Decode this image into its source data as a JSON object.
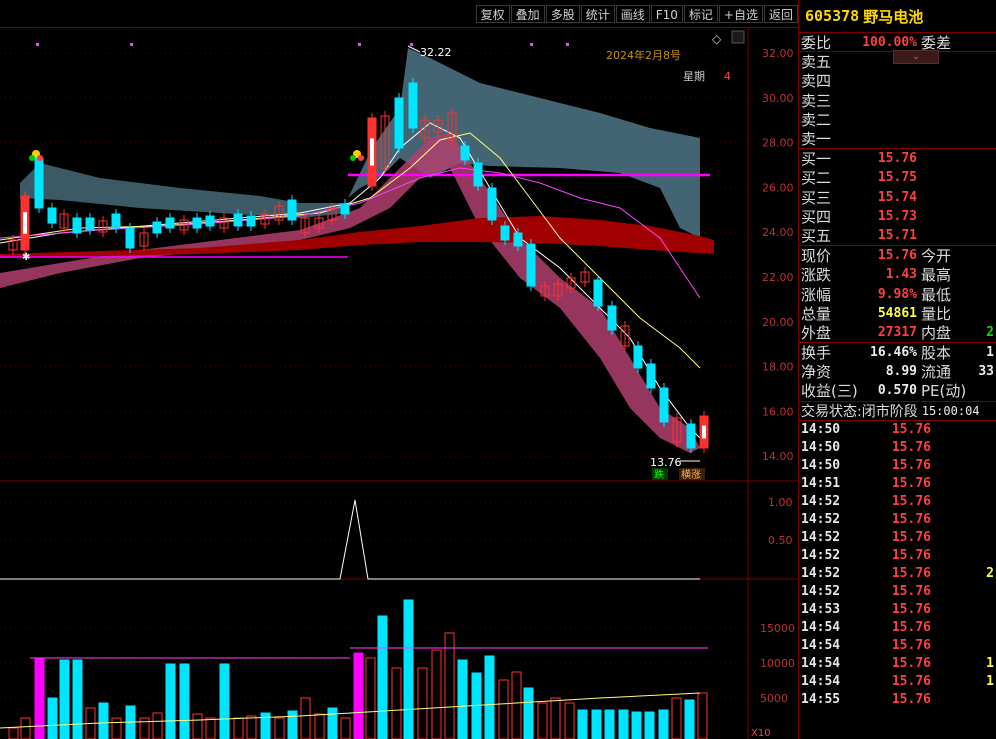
{
  "toolbar": {
    "buttons": [
      "复权",
      "叠加",
      "多股",
      "统计",
      "画线",
      "F10",
      "标记",
      "+自选",
      "返回"
    ]
  },
  "chart": {
    "date_label": "2024年2月8号",
    "weekday_label": "星期",
    "weekday_value": "4",
    "high_label": "32.22",
    "low_label": "13.76",
    "badge_left": "跌",
    "badge_right": "横涨",
    "price_ticks": [
      "32.00",
      "30.00",
      "28.00",
      "26.00",
      "24.00",
      "22.00",
      "20.00",
      "18.00",
      "16.00",
      "14.00"
    ],
    "ind_ticks": [
      "1.00",
      "0.50"
    ],
    "vol_ticks": [
      "15000",
      "10000",
      "5000"
    ],
    "vol_unit": "X10",
    "colors": {
      "up": "#ff3030",
      "down": "#00e5ff",
      "magenta": "#ff00ff",
      "cloud": "#4a7080",
      "band": "#b0003a"
    }
  },
  "stock": {
    "code": "605378",
    "name": "野马电池"
  },
  "weibi": {
    "label": "委比",
    "value": "100.00%",
    "label2": "委差"
  },
  "sells": [
    "卖五",
    "卖四",
    "卖三",
    "卖二",
    "卖一"
  ],
  "buys": [
    {
      "label": "买一",
      "price": "15.76"
    },
    {
      "label": "买二",
      "price": "15.75"
    },
    {
      "label": "买三",
      "price": "15.74"
    },
    {
      "label": "买四",
      "price": "15.73"
    },
    {
      "label": "买五",
      "price": "15.71"
    }
  ],
  "stats": [
    {
      "l1": "现价",
      "v1": "15.76",
      "c1": "red",
      "l2": "今开",
      "v2": ""
    },
    {
      "l1": "涨跌",
      "v1": "1.43",
      "c1": "red",
      "l2": "最高",
      "v2": ""
    },
    {
      "l1": "涨幅",
      "v1": "9.98%",
      "c1": "red",
      "l2": "最低",
      "v2": ""
    },
    {
      "l1": "总量",
      "v1": "54861",
      "c1": "yellow",
      "l2": "量比",
      "v2": ""
    },
    {
      "l1": "外盘",
      "v1": "27317",
      "c1": "red",
      "l2": "内盘",
      "v2": "2"
    }
  ],
  "stats2": [
    {
      "l1": "换手",
      "v1": "16.46%",
      "l2": "股本",
      "v2": "1"
    },
    {
      "l1": "净资",
      "v1": "8.99",
      "l2": "流通",
      "v2": "33"
    },
    {
      "l1": "收益(三)",
      "v1": "0.570",
      "l2": "PE(动)",
      "v2": ""
    }
  ],
  "trade_status": {
    "label": "交易状态:",
    "value": "闭市阶段",
    "time": "15:00:04"
  },
  "ticks": [
    {
      "t": "14:50",
      "p": "15.76",
      "v": ""
    },
    {
      "t": "14:50",
      "p": "15.76",
      "v": ""
    },
    {
      "t": "14:50",
      "p": "15.76",
      "v": ""
    },
    {
      "t": "14:51",
      "p": "15.76",
      "v": ""
    },
    {
      "t": "14:52",
      "p": "15.76",
      "v": ""
    },
    {
      "t": "14:52",
      "p": "15.76",
      "v": ""
    },
    {
      "t": "14:52",
      "p": "15.76",
      "v": ""
    },
    {
      "t": "14:52",
      "p": "15.76",
      "v": ""
    },
    {
      "t": "14:52",
      "p": "15.76",
      "v": "2"
    },
    {
      "t": "14:52",
      "p": "15.76",
      "v": ""
    },
    {
      "t": "14:53",
      "p": "15.76",
      "v": ""
    },
    {
      "t": "14:54",
      "p": "15.76",
      "v": ""
    },
    {
      "t": "14:54",
      "p": "15.76",
      "v": ""
    },
    {
      "t": "14:54",
      "p": "15.76",
      "v": "1"
    },
    {
      "t": "14:54",
      "p": "15.76",
      "v": "1"
    },
    {
      "t": "14:55",
      "p": "15.76",
      "v": ""
    }
  ]
}
